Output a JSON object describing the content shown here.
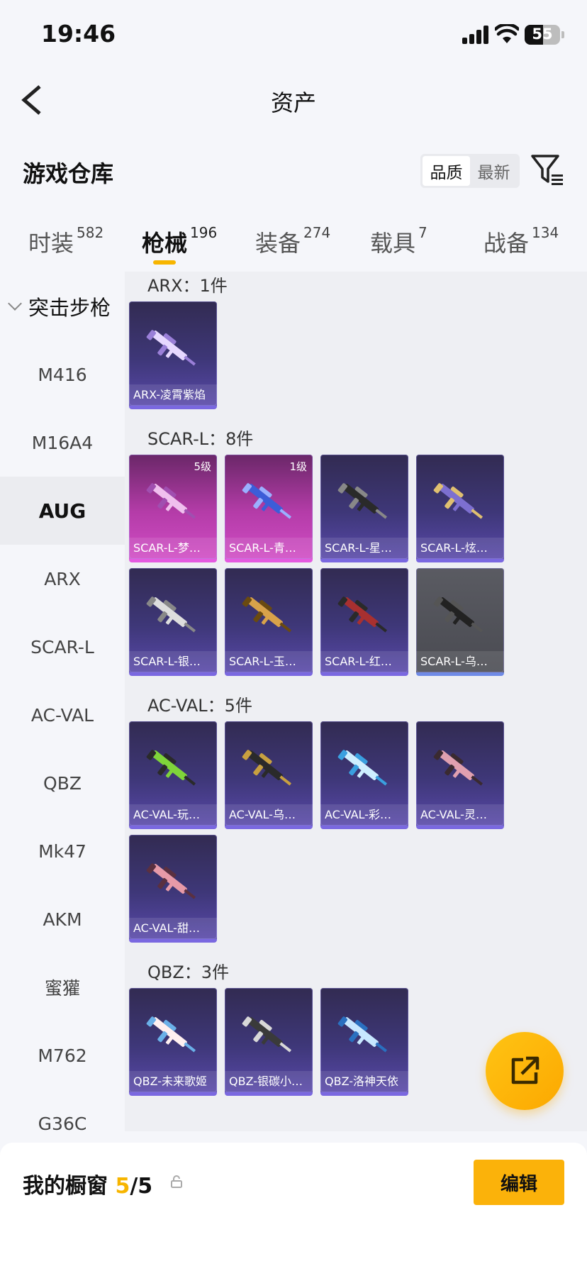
{
  "status_bar": {
    "time": "19:46",
    "battery": "55"
  },
  "nav": {
    "title": "资产"
  },
  "warehouse": {
    "title": "游戏仓库",
    "sort_options": [
      {
        "label": "品质",
        "selected": true
      },
      {
        "label": "最新",
        "selected": false
      }
    ]
  },
  "tabs": [
    {
      "label": "时装",
      "count": "582"
    },
    {
      "label": "枪械",
      "count": "196",
      "active": true
    },
    {
      "label": "装备",
      "count": "274"
    },
    {
      "label": "载具",
      "count": "7"
    },
    {
      "label": "战备",
      "count": "134"
    }
  ],
  "sidebar": {
    "group": "突击步枪",
    "items": [
      "M416",
      "M16A4",
      "AUG",
      "ARX",
      "SCAR-L",
      "AC-VAL",
      "QBZ",
      "Mk47",
      "AKM",
      "蜜獾",
      "M762",
      "G36C"
    ],
    "active_item": "AUG"
  },
  "sections": [
    {
      "title": "ARX：1件",
      "items": [
        {
          "name": "ARX-凌霄紫焰"
        }
      ]
    },
    {
      "title": "SCAR-L：8件",
      "items": [
        {
          "name": "SCAR-L-梦…",
          "level": "5级"
        },
        {
          "name": "SCAR-L-青…",
          "level": "1级"
        },
        {
          "name": "SCAR-L-星…"
        },
        {
          "name": "SCAR-L-炫…"
        },
        {
          "name": "SCAR-L-银…"
        },
        {
          "name": "SCAR-L-玉…"
        },
        {
          "name": "SCAR-L-红…"
        },
        {
          "name": "SCAR-L-乌…"
        }
      ]
    },
    {
      "title": "AC-VAL：5件",
      "items": [
        {
          "name": "AC-VAL-玩…"
        },
        {
          "name": "AC-VAL-乌…"
        },
        {
          "name": "AC-VAL-彩…"
        },
        {
          "name": "AC-VAL-灵…"
        },
        {
          "name": "AC-VAL-甜…"
        }
      ]
    },
    {
      "title": "QBZ：3件",
      "items": [
        {
          "name": "QBZ-未来歌姬"
        },
        {
          "name": "QBZ-银碳小…"
        },
        {
          "name": "QBZ-洛神天依"
        }
      ]
    }
  ],
  "showcase": {
    "label": "我的橱窗",
    "count": "5",
    "separator": "/",
    "total": "5",
    "edit_label": "编辑"
  }
}
